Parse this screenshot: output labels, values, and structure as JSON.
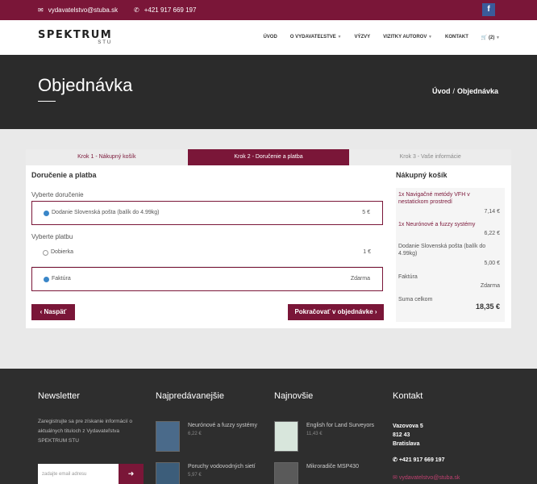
{
  "topbar": {
    "email": "vydavatelstvo@stuba.sk",
    "phone": "+421 917 669 197",
    "facebook": "f"
  },
  "nav": {
    "logo_main": "SPEKTRUM",
    "logo_sub": "STU",
    "items": [
      {
        "label": "ÚVOD",
        "caret": false
      },
      {
        "label": "O VYDAVATEĽSTVE",
        "caret": true
      },
      {
        "label": "VÝZVY",
        "caret": false
      },
      {
        "label": "VIZITKY AUTOROV",
        "caret": true
      },
      {
        "label": "KONTAKT",
        "caret": false
      }
    ],
    "cart_count": "(2)"
  },
  "hero": {
    "title": "Objednávka",
    "breadcrumb_home": "Úvod",
    "breadcrumb_sep": "/",
    "breadcrumb_current": "Objednávka"
  },
  "steps": [
    {
      "label": "Krok 1 - Nákupný košík",
      "state": "done"
    },
    {
      "label": "Krok 2 - Doručenie a platba",
      "state": "active"
    },
    {
      "label": "Krok 3 - Vaše informácie",
      "state": "todo"
    }
  ],
  "form": {
    "section_title": "Doručenie a platba",
    "delivery_label": "Vyberte doručenie",
    "delivery_option": "Dodanie Slovenská pošta",
    "delivery_note": "(balík do 4.99kg)",
    "delivery_price": "5 €",
    "payment_label": "Vyberte platbu",
    "payment_options": [
      {
        "label": "Dobierka",
        "price": "1 €",
        "selected": false
      },
      {
        "label": "Faktúra",
        "price": "Zdarma",
        "selected": true
      }
    ],
    "back_button": "‹ Naspäť",
    "next_button": "Pokračovať v objednávke ›"
  },
  "cart": {
    "title": "Nákupný košík",
    "items": [
      {
        "name": "1x Navigačné metódy VFH v nestatickom prostredí",
        "price": "7,14 €"
      },
      {
        "name": "1x Neurónové a fuzzy systémy",
        "price": "6,22 €"
      },
      {
        "name": "Dodanie Slovenská pošta (balík do 4.99kg)",
        "price": "5,00 €"
      },
      {
        "name": "Faktúra",
        "price": "Zdarma"
      }
    ],
    "total_label": "Suma celkom",
    "total_value": "18,35 €"
  },
  "footer": {
    "newsletter_title": "Newsletter",
    "newsletter_text": "Zaregistrujte sa pre získanie informácií o aktuálnych tituloch z Vydavateľstva SPEKTRUM STU",
    "email_placeholder": "zadajte email adresu",
    "bestsellers_title": "Najpredávanejšie",
    "bestsellers": [
      {
        "name": "Neurónové a fuzzy systémy",
        "price": "6,22 €"
      },
      {
        "name": "Poruchy vodovodných sietí",
        "price": "5,97 €"
      }
    ],
    "newest_title": "Najnovšie",
    "newest": [
      {
        "name": "English for Land Surveyors",
        "price": "11,43 €"
      },
      {
        "name": "Mikroradiče MSP430",
        "price": ""
      }
    ],
    "contact_title": "Kontakt",
    "street": "Vazovova 5",
    "zip": "812 43",
    "city": "Bratislava",
    "phone": "+421 917 669 197",
    "email": "vydavatelstvo@stuba.sk"
  }
}
